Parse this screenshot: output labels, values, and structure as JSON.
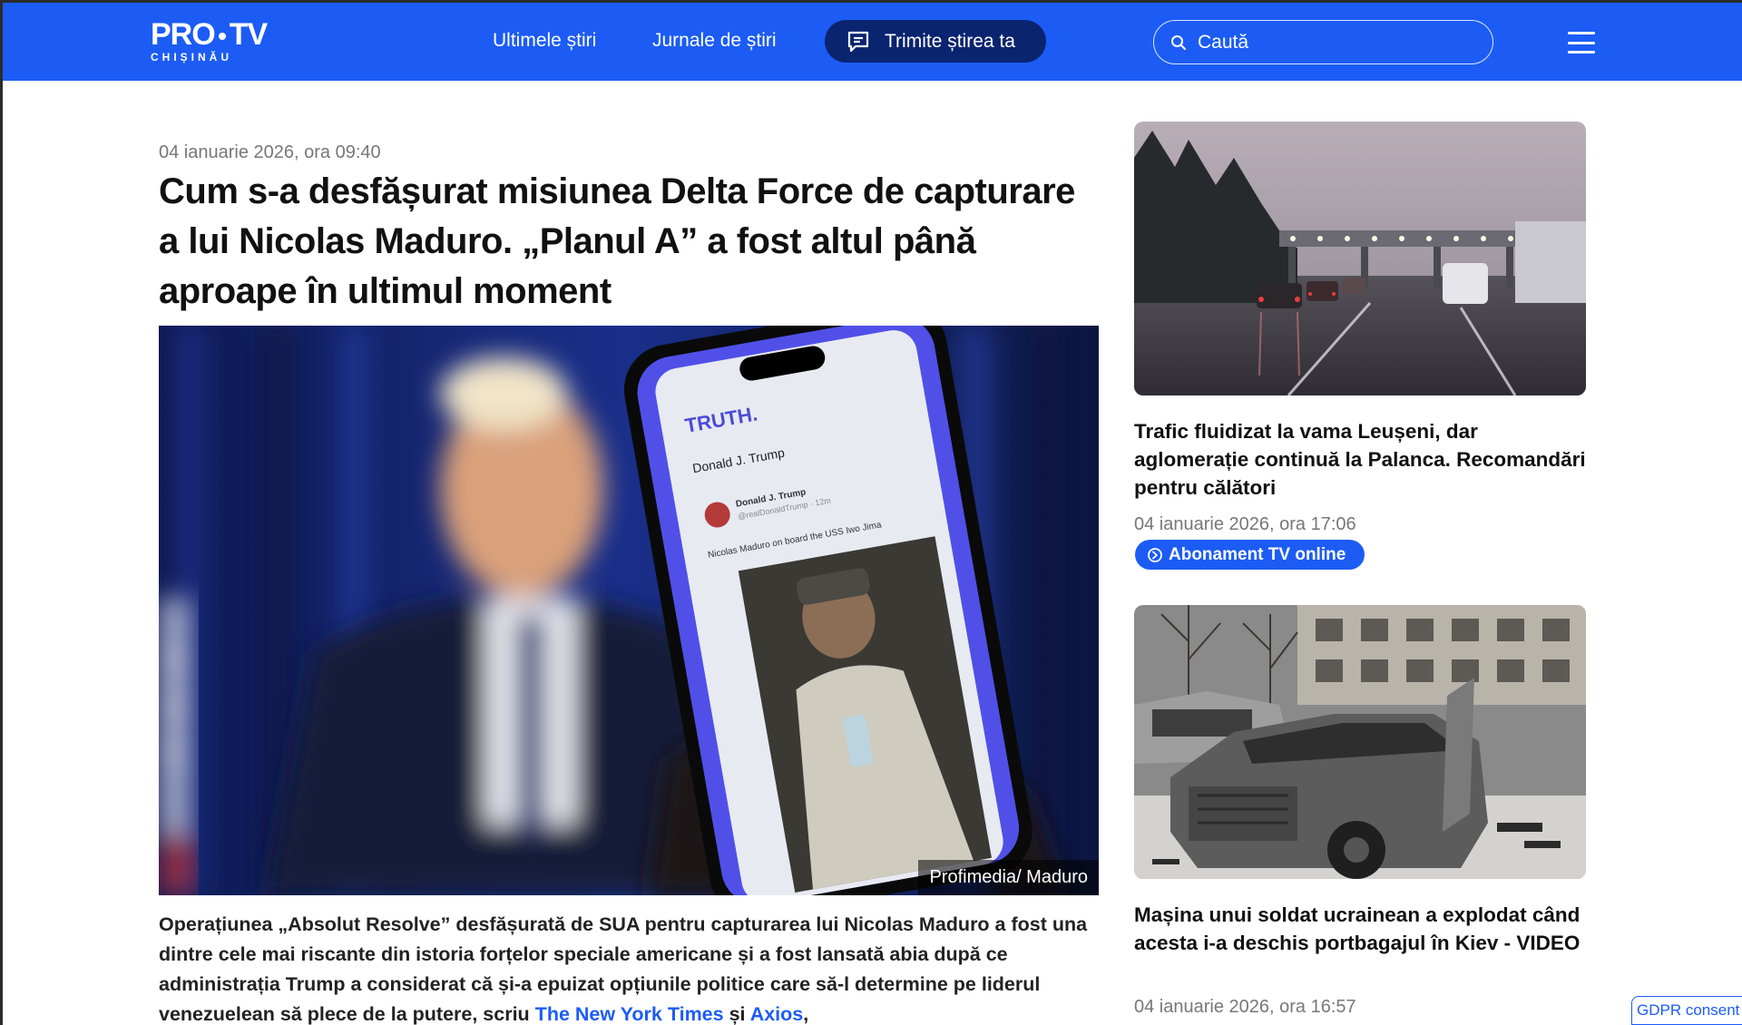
{
  "header": {
    "logo_main_left": "PRO",
    "logo_main_right": "TV",
    "logo_sub": "CHIȘINĂU",
    "nav": [
      "Ultimele știri",
      "Jurnale de știri"
    ],
    "send_news_label": "Trimite știrea ta",
    "search_placeholder": "Caută"
  },
  "article": {
    "date": "04 ianuarie 2026, ora 09:40",
    "title": "Cum s-a desfășurat misiunea Delta Force de capturare a lui Nicolas Maduro. „Planul A” a fost altul până aproape în ultimul moment",
    "image_credit": "Profimedia/ Maduro",
    "image_caption_phone": {
      "app": "TRUTH.",
      "profile": "Donald J. Trump",
      "post_author": "Donald J. Trump",
      "handle": "@realDonaldTrump · 12m",
      "post_text": "Nicolas Maduro on board the USS Iwo Jima"
    },
    "body_text": "Operațiunea „Absolut Resolve” desfășurată de SUA pentru capturarea lui Nicolas Maduro a fost una dintre cele mai riscante din istoria forțelor speciale americane și a fost lansată abia după ce administrația Trump a considerat că și-a epuizat opțiunile politice care să-l determine pe liderul venezuelean să plece de la putere, scriu",
    "link_1": "The New York Times",
    "conj": " și ",
    "link_2": "Axios",
    "trailing": ","
  },
  "sidebar": {
    "cards": [
      {
        "title": "Trafic fluidizat la vama Leușeni, dar aglomerație continuă la Palanca. Recomandări pentru călători",
        "date": "04 ianuarie 2026, ora 17:06"
      },
      {
        "title": "Mașina unui soldat ucrainean a explodat când acesta i-a deschis portbagajul în Kiev - VIDEO",
        "date": "04 ianuarie 2026, ora 16:57"
      }
    ],
    "subscribe_label": "Abonament TV online"
  },
  "gdpr_label": "GDPR consent",
  "colors": {
    "brand_blue": "#1c5cf5",
    "dark_navy": "#0b2470"
  },
  "icons": [
    "chat-bubble-icon",
    "search-icon",
    "hamburger-menu-icon",
    "plus-circle-icon"
  ]
}
